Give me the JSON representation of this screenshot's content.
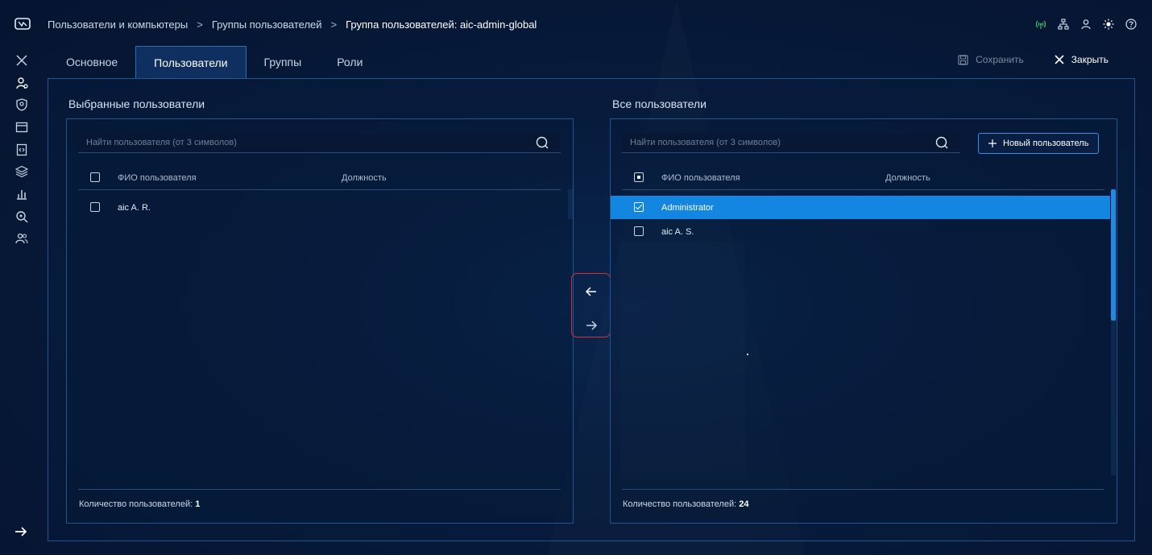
{
  "breadcrumb": {
    "item1": "Пользователи и компьютеры",
    "item2": "Группы пользователей",
    "current": "Группа пользователей: aic-admin-global",
    "separator": ">"
  },
  "tabs": {
    "main": "Основное",
    "users": "Пользователи",
    "groups": "Группы",
    "roles": "Роли"
  },
  "actions": {
    "save": "Сохранить",
    "close": "Закрыть"
  },
  "selected_panel": {
    "title": "Выбранные пользователи",
    "search_placeholder": "Найти пользователя (от 3 символов)",
    "col_name": "ФИО пользователя",
    "col_position": "Должность",
    "rows": [
      {
        "name": "aic A. R.",
        "position": ""
      }
    ],
    "count_label": "Количество пользователей:",
    "count_value": "1"
  },
  "all_panel": {
    "title": "Все пользователи",
    "search_placeholder": "Найти пользователя (от 3 символов)",
    "new_user_button": "Новый пользователь",
    "col_name": "ФИО пользователя",
    "col_position": "Должность",
    "rows": [
      {
        "name": "Administrator",
        "position": "",
        "selected": true
      },
      {
        "name": "aic A. S.",
        "position": "",
        "selected": false
      }
    ],
    "count_label": "Количество пользователей:",
    "count_value": "24"
  },
  "colors": {
    "accent": "#1286e0",
    "border": "#24548f",
    "highlight": "#d23240",
    "status_green": "#3fbf6a"
  }
}
